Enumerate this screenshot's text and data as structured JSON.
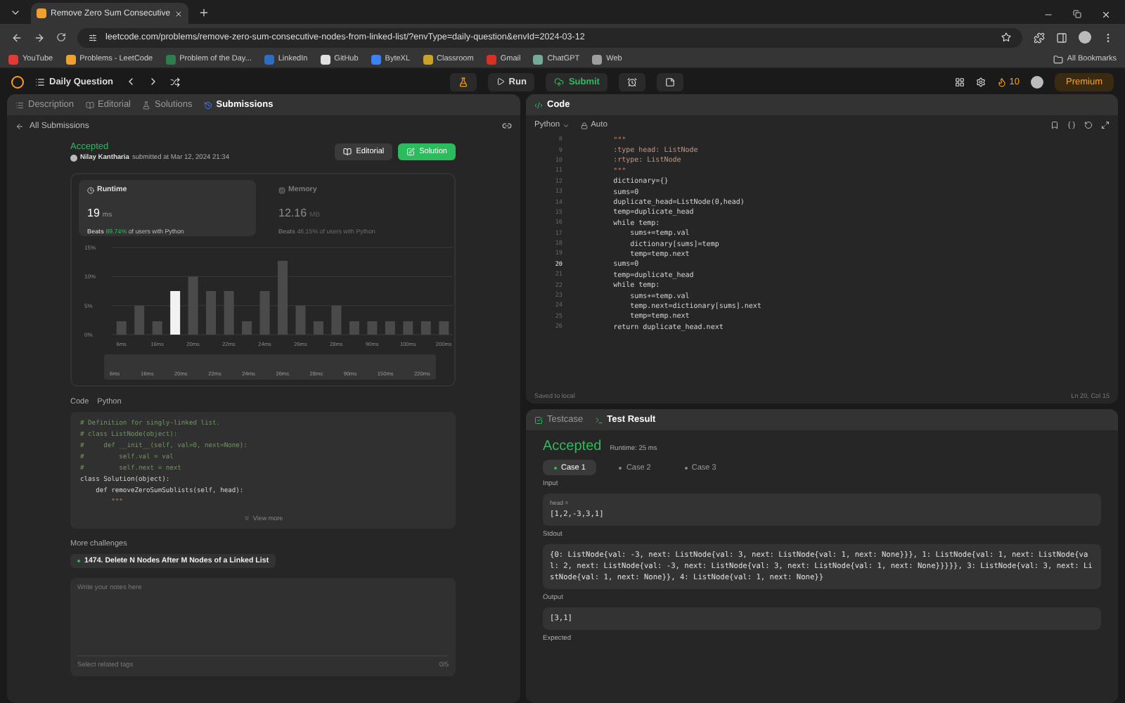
{
  "browser": {
    "tab_title": "Remove Zero Sum Consecutive",
    "url": "leetcode.com/problems/remove-zero-sum-consecutive-nodes-from-linked-list/?envType=daily-question&envId=2024-03-12",
    "bookmarks": [
      {
        "label": "YouTube",
        "color": "#e53935"
      },
      {
        "label": "Problems - LeetCode",
        "color": "#f0a030"
      },
      {
        "label": "Problem of the Day...",
        "color": "#2e7d4f"
      },
      {
        "label": "LinkedIn",
        "color": "#2a6fc0"
      },
      {
        "label": "GitHub",
        "color": "#e0e0e0"
      },
      {
        "label": "ByteXL",
        "color": "#3b82f6"
      },
      {
        "label": "Classroom",
        "color": "#c9a227"
      },
      {
        "label": "Gmail",
        "color": "#d93025"
      },
      {
        "label": "ChatGPT",
        "color": "#74aa9c"
      },
      {
        "label": "Web",
        "color": "#9e9e9e"
      }
    ],
    "all_bookmarks": "All Bookmarks"
  },
  "navbar": {
    "title": "Daily Question",
    "run": "Run",
    "submit": "Submit",
    "streak": "10",
    "premium": "Premium"
  },
  "left_tabs": [
    {
      "label": "Description",
      "selected": false
    },
    {
      "label": "Editorial",
      "selected": false
    },
    {
      "label": "Solutions",
      "selected": false
    },
    {
      "label": "Submissions",
      "selected": true
    }
  ],
  "back_link": "All Submissions",
  "submission": {
    "status": "Accepted",
    "author": "Nilay Kantharia",
    "submitted": "submitted at Mar 12, 2024 21:34",
    "buttons": [
      {
        "label": "Editorial",
        "kind": "secondary"
      },
      {
        "label": "Solution",
        "kind": "primary"
      }
    ]
  },
  "metrics": [
    {
      "label": "Runtime",
      "value": "19",
      "unit": "ms",
      "beats_label": "Beats",
      "beats": "89.74%",
      "suffix": "of users with Python",
      "selected": true
    },
    {
      "label": "Memory",
      "value": "12.16",
      "unit": "MB",
      "beats_label": "Beats",
      "beats": "46.15%",
      "suffix": "of users with Python",
      "selected": false
    }
  ],
  "chart_data": {
    "type": "bar",
    "categories": [
      "6ms",
      null,
      "16ms",
      null,
      "20ms",
      null,
      "22ms",
      null,
      "24ms",
      null,
      "26ms",
      null,
      "28ms",
      null,
      "90ms",
      null,
      "100ms",
      null,
      "200ms"
    ],
    "ylim": [
      0,
      15
    ],
    "yticks": [
      {
        "value": 0,
        "label": "0%"
      },
      {
        "value": 5,
        "label": "5%"
      },
      {
        "value": 10,
        "label": "10%"
      },
      {
        "value": 15,
        "label": "15%"
      }
    ],
    "series": [
      {
        "color": "#4a4a4a",
        "values": [
          2.3,
          5,
          2.3,
          null,
          10,
          7.5,
          7.5,
          2.3,
          7.5,
          12.7,
          5,
          2.3,
          5,
          2.3,
          2.3,
          2.3,
          2.3,
          2.3,
          2.3
        ]
      },
      {
        "color": "#f2f2f2",
        "values": [
          null,
          null,
          null,
          7.5,
          null,
          null,
          null,
          null,
          null,
          null,
          null,
          null,
          null,
          null,
          null,
          null,
          null,
          null,
          null
        ]
      }
    ]
  },
  "range": {
    "level": 1,
    "labels": [
      "6ms",
      "16ms",
      "20ms",
      "22ms",
      "24ms",
      "26ms",
      "28ms",
      "90ms",
      "150ms",
      "220ms"
    ]
  },
  "code_section": {
    "label": "Code",
    "language": "Python",
    "view_more": "View more",
    "lines": [
      {
        "kind": "comment",
        "text": "# Definition for singly-linked list."
      },
      {
        "kind": "comment",
        "text": "# class ListNode(object):"
      },
      {
        "kind": "comment",
        "text": "#     def __init__(self, val=0, next=None):"
      },
      {
        "kind": "comment",
        "text": "#         self.val = val"
      },
      {
        "kind": "comment",
        "text": "#         self.next = next"
      },
      {
        "kind": "code",
        "text": "class Solution(object):"
      },
      {
        "kind": "code",
        "text": "    def removeZeroSumSublists(self, head):"
      },
      {
        "kind": "string",
        "text": "        \"\"\""
      }
    ]
  },
  "more_challenges": {
    "title": "More challenges",
    "items": [
      "1474. Delete N Nodes After M Nodes of a Linked List"
    ]
  },
  "notes": {
    "placeholder": "Write your notes here",
    "tags_placeholder": "Select related tags",
    "count": "0/5"
  },
  "editor": {
    "title": "Code",
    "language": "Python",
    "mode": "Auto",
    "status_left": "Saved to local",
    "status_right": "Ln 20, Col 15",
    "lines": [
      {
        "number": "8",
        "kind": "string",
        "text": "        \"\"\"",
        "current": false
      },
      {
        "number": "9",
        "kind": "string",
        "text": "        :type head: ListNode",
        "current": false
      },
      {
        "number": "10",
        "kind": "string",
        "text": "        :rtype: ListNode",
        "current": false
      },
      {
        "number": "11",
        "kind": "string",
        "text": "        \"\"\"",
        "current": false
      },
      {
        "number": "12",
        "kind": "code",
        "text": "        dictionary={}",
        "current": false
      },
      {
        "number": "13",
        "kind": "code",
        "text": "        sums=0",
        "current": false
      },
      {
        "number": "14",
        "kind": "code",
        "text": "        duplicate_head=ListNode(0,head)",
        "current": false
      },
      {
        "number": "15",
        "kind": "code",
        "text": "        temp=duplicate_head",
        "current": false
      },
      {
        "number": "16",
        "kind": "code",
        "text": "        while temp:",
        "current": false
      },
      {
        "number": "17",
        "kind": "code",
        "text": "            sums+=temp.val",
        "current": false
      },
      {
        "number": "18",
        "kind": "code",
        "text": "            dictionary[sums]=temp",
        "current": false
      },
      {
        "number": "19",
        "kind": "code",
        "text": "            temp=temp.next",
        "current": false
      },
      {
        "number": "20",
        "kind": "code",
        "text": "        sums=0",
        "current": true
      },
      {
        "number": "21",
        "kind": "code",
        "text": "        temp=duplicate_head",
        "current": false
      },
      {
        "number": "22",
        "kind": "code",
        "text": "        while temp:",
        "current": false
      },
      {
        "number": "23",
        "kind": "code",
        "text": "            sums+=temp.val",
        "current": false
      },
      {
        "number": "24",
        "kind": "code",
        "text": "            temp.next=dictionary[sums].next",
        "current": false
      },
      {
        "number": "25",
        "kind": "code",
        "text": "            temp=temp.next",
        "current": false
      },
      {
        "number": "26",
        "kind": "code",
        "text": "        return duplicate_head.next",
        "current": false
      }
    ]
  },
  "result": {
    "tabs": [
      {
        "label": "Testcase",
        "selected": false
      },
      {
        "label": "Test Result",
        "selected": true
      }
    ],
    "status": "Accepted",
    "runtime": "Runtime: 25 ms",
    "cases": [
      {
        "label": "Case 1",
        "selected": true
      },
      {
        "label": "Case 2",
        "selected": false
      },
      {
        "label": "Case 3",
        "selected": false
      }
    ],
    "sections": [
      {
        "label": "Input",
        "variable": "head =",
        "value": "[1,2,-3,3,1]"
      },
      {
        "label": "Stdout",
        "value": "{0: ListNode{val: -3, next: ListNode{val: 3, next: ListNode{val: 1, next: None}}}, 1: ListNode{val: 1, next: ListNode{val: 2, next: ListNode{val: -3, next: ListNode{val: 3, next: ListNode{val: 1, next: None}}}}}, 3: ListNode{val: 3, next: ListNode{val: 1, next: None}}, 4: ListNode{val: 1, next: None}}"
      },
      {
        "label": "Output",
        "value": "[3,1]"
      },
      {
        "label": "Expected"
      }
    ]
  }
}
